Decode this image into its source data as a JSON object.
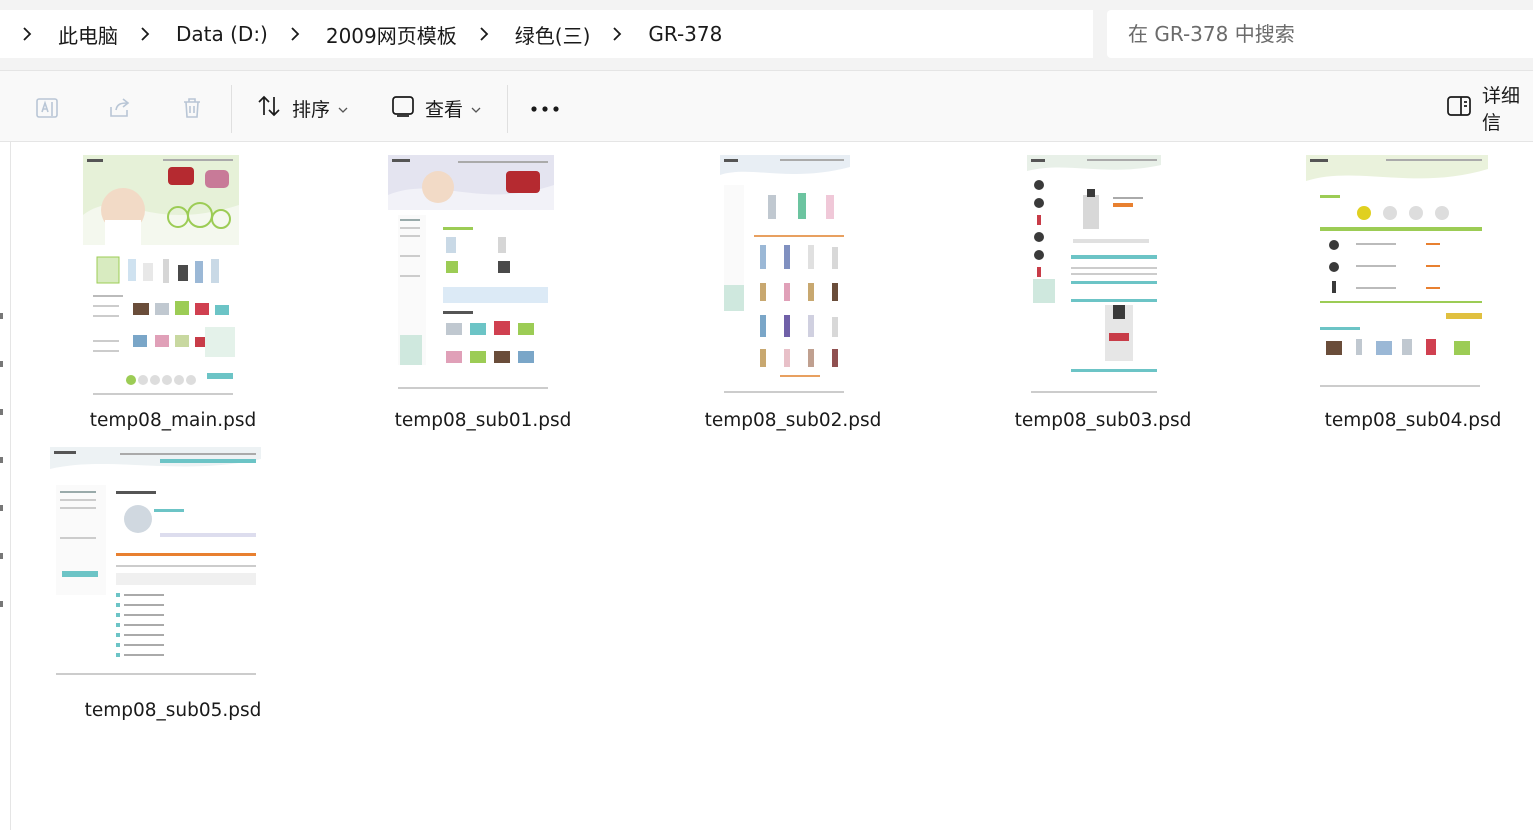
{
  "breadcrumb": {
    "items": [
      "此电脑",
      "Data (D:)",
      "2009网页模板",
      "绿色(三)",
      "GR-378"
    ]
  },
  "search": {
    "placeholder": "在 GR-378 中搜索"
  },
  "toolbar": {
    "sort_label": "排序",
    "view_label": "查看",
    "more_label": "···",
    "details_label": "详细信"
  },
  "files": [
    {
      "name": "temp08_main.psd"
    },
    {
      "name": "temp08_sub01.psd"
    },
    {
      "name": "temp08_sub02.psd"
    },
    {
      "name": "temp08_sub03.psd"
    },
    {
      "name": "temp08_sub04.psd"
    },
    {
      "name": "temp08_sub05.psd"
    }
  ],
  "colors": {
    "accent_green": "#9ccc55",
    "accent_teal": "#6cc4c6",
    "toolbar_bg": "#f9f9f9",
    "address_bg": "#f3f3f3"
  }
}
